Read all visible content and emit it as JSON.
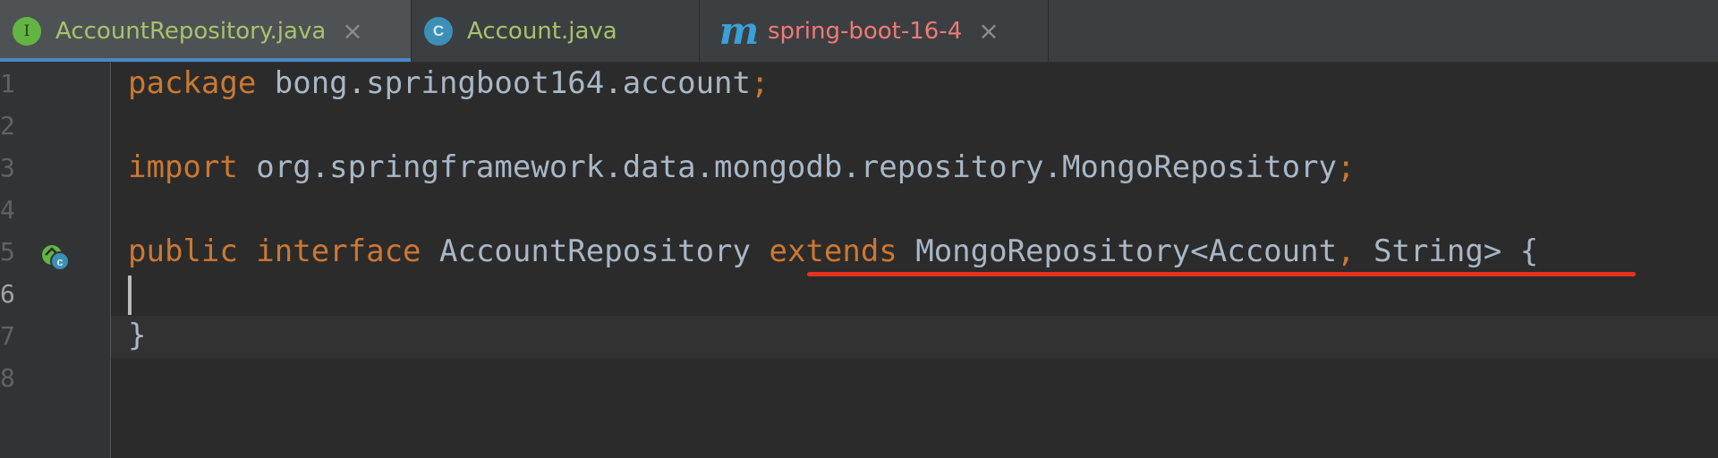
{
  "tabs": [
    {
      "label": "AccountRepository.java",
      "icon_letter": "I",
      "icon": "interface-icon",
      "active": true
    },
    {
      "label": "Account.java",
      "icon_letter": "C",
      "icon": "class-icon",
      "active": false
    },
    {
      "label": "spring-boot-16-4",
      "icon_letter": "m",
      "icon": "maven-icon",
      "active": false
    }
  ],
  "close_glyph": "×",
  "line_numbers": [
    "1",
    "2",
    "3",
    "4",
    "5",
    "6",
    "7",
    "8"
  ],
  "code": {
    "line1": {
      "kw": "package",
      "name": " bong.springboot164.account",
      "semi": ";"
    },
    "line3": {
      "kw": "import",
      "name": " org.springframework.data.mongodb.repository.MongoRepository",
      "semi": ";"
    },
    "line5": {
      "kw1": "public",
      "kw2": " interface",
      "name": " AccountRepository ",
      "kw3": "extends",
      "type1": " MongoRepository<Account",
      "comma": ",",
      "type2": " String>",
      "brace": " {"
    },
    "line7": {
      "brace": "}"
    }
  },
  "colors": {
    "keyword": "#cc7832",
    "identifier": "#a9b7c6",
    "tab_java_file": "#a7c36b",
    "tab_project": "#ef7a76",
    "error_underline": "#e8301f",
    "active_tab_indicator": "#4a88c7"
  },
  "gutter_marker": "implemented-interface-icon",
  "current_line": 6
}
